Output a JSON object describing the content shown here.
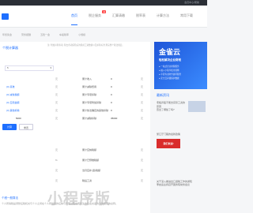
{
  "topbar": {
    "right_text": "会员中心/帮助"
  },
  "nav": {
    "items": [
      {
        "label": "首页",
        "active": true
      },
      {
        "label": "税企服务",
        "badge": "热"
      },
      {
        "label": "汇算清缴"
      },
      {
        "label": "税率表"
      },
      {
        "label": "计算方法"
      },
      {
        "label": "常用下载"
      }
    ]
  },
  "subnav": [
    "年终奖金",
    "劳务报酬",
    "五险一金",
    "车船税率",
    "小规模"
  ],
  "calc": {
    "title": "个税计算器",
    "desc": "注: 附加扣除专项; 除去各项保险后的税前工资数额以及扣除标准;算完整个税法规定。",
    "select_value": "5",
    "rows": [
      {
        "left_label": "",
        "unit": "元",
        "right_label": "累计收入",
        "right_val": "0",
        "right_unit": "元"
      },
      {
        "left_label": "(0) 基准",
        "unit": "元",
        "right_label": "累计减除费用",
        "right_val": "0",
        "right_unit": "元"
      },
      {
        "left_label": "(0) 减免税额",
        "unit": "元",
        "right_label": "累计专项扣除",
        "right_val": "0",
        "right_unit": "元"
      },
      {
        "left_label": "(0) 五险金额",
        "unit": "元",
        "right_label": "累计专项附加扣除",
        "right_val": "0",
        "right_unit": "元"
      },
      {
        "left_label": "(0) 其他扣除",
        "unit": "元",
        "right_label": "累计依法确定的其他扣除",
        "right_val": "0",
        "right_unit": "元"
      },
      {
        "left_label": "5000",
        "unit": "元",
        "right_label": "累计减除扣除",
        "right_val": "35000",
        "right_unit": "元"
      }
    ],
    "calc_button": "计算",
    "reset_button": "重置",
    "result_rows": [
      {
        "left_label": "元",
        "right_label": "累计应纳税额",
        "right_unit": "元"
      },
      {
        "left_label": "%",
        "right_label": "累计已预缴税额",
        "right_unit": "元"
      },
      {
        "left_label": "元",
        "right_label": "当月应补(退)税额",
        "right_unit": "元"
      },
      {
        "left_label": "元",
        "right_label": "税后工资",
        "right_unit": "元"
      }
    ],
    "footer_title": "个税一般算法",
    "footer_text": "个人所得税是调整征税机关与个人之间在个人所得税的征纳与管理过程中所发生的社会关系的法律规范的总称。"
  },
  "side": {
    "banner_title": "金雀云",
    "banner_sub": "轻松解决企业财税",
    "banner_items": [
      "● 一站式企业财税服务",
      "● 融入小程序使用流畅",
      "● 享受专业财务顾问服务",
      "● 安全云存储保护数据"
    ],
    "section_title": "最新资讯",
    "news": [
      "老板养股不能去实际工资的原因",
      "查出了哪些了吗?",
      "浙江厅门路的最新政策"
    ],
    "ad_text": "我们欢迎!",
    "more_news": [
      "关于深入推进出口退税工作的通知",
      "李启运主持召开国务院常务会议"
    ]
  },
  "watermark": "小程序版"
}
